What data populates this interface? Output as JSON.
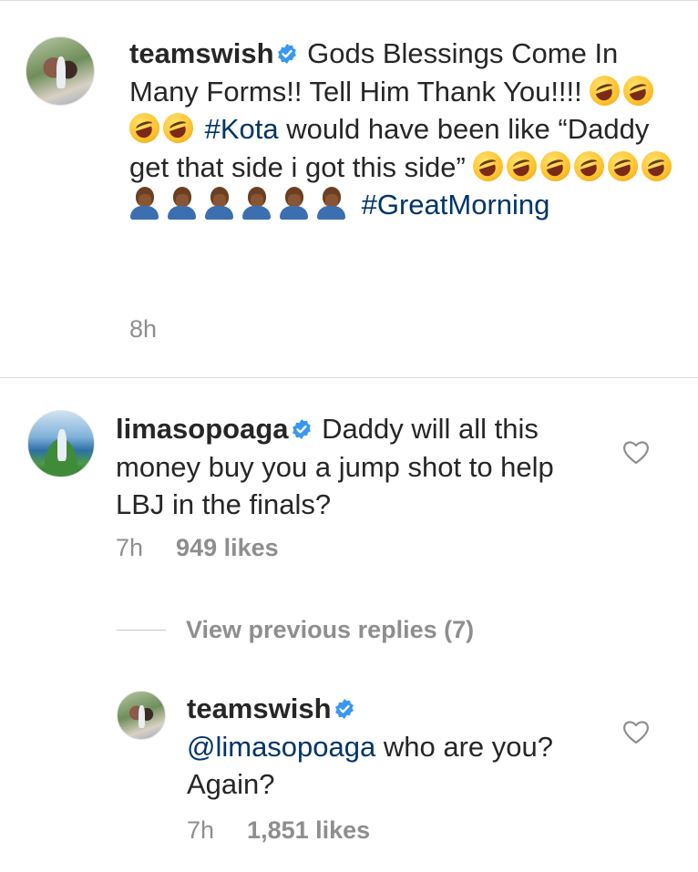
{
  "caption": {
    "username": "teamswish",
    "text_1": "Gods Blessings Come In Many Forms!! Tell Him Thank You!!!!",
    "hashtag_1": "#Kota",
    "text_2": "would have been like “Daddy get that side i got this side”",
    "hashtag_2": "#GreatMorning",
    "time": "8h",
    "emoji_icons": [
      "rolling-on-floor-laughing-icon",
      "facepalm-icon"
    ]
  },
  "comment": {
    "username": "limasopoaga",
    "text": "Daddy will all this money buy you a jump shot to help LBJ in the finals?",
    "time": "7h",
    "likes": "949 likes"
  },
  "view_previous_replies": "View previous replies (7)",
  "reply": {
    "username": "teamswish",
    "mention": "@limasopoaga",
    "text": "who are you? Again?",
    "time": "7h",
    "likes": "1,851 likes"
  },
  "colors": {
    "text": "#262626",
    "link": "#003569",
    "meta": "#8e8e8e",
    "verified": "#3897f0",
    "divider": "#dbdbdb"
  }
}
